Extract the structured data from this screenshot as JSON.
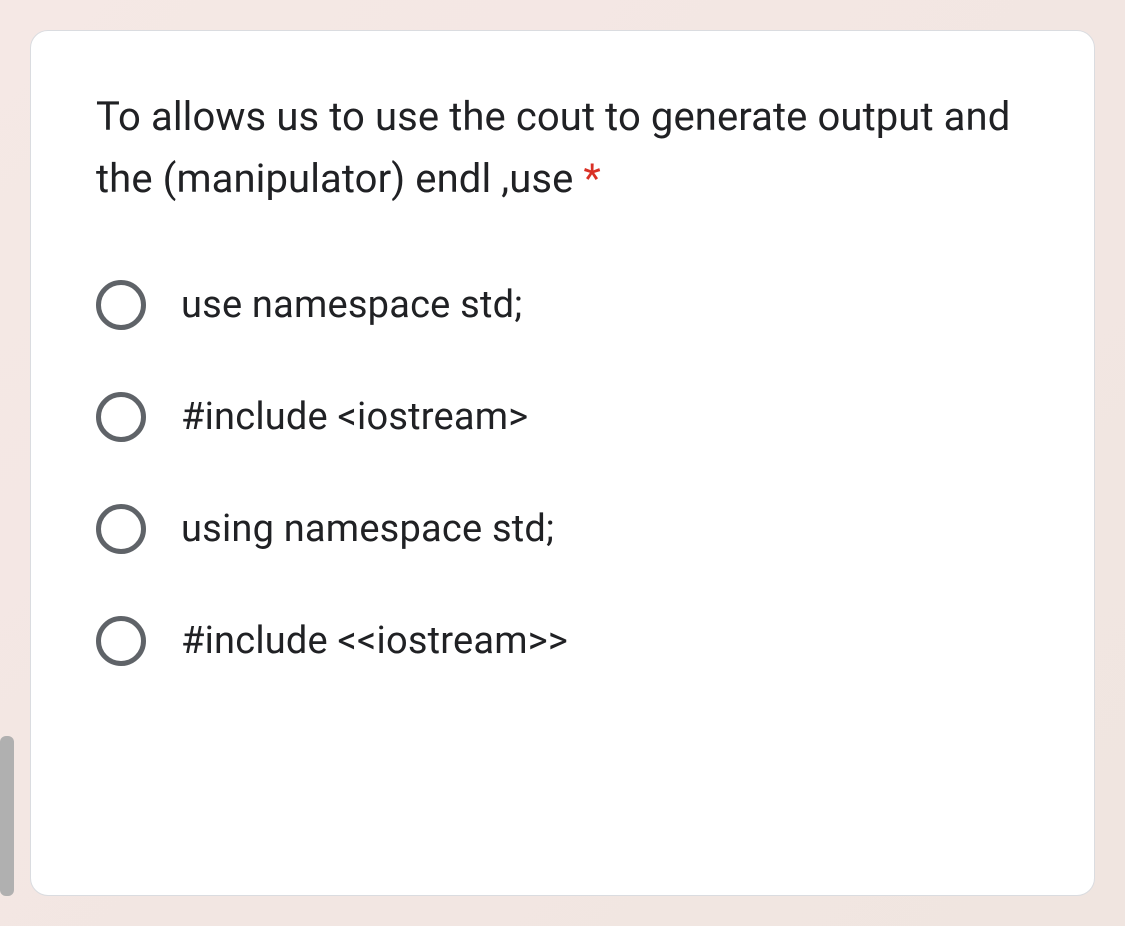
{
  "question": {
    "text": "To allows us to use the cout to generate output and the (manipulator) endl ,use ",
    "required_marker": "*"
  },
  "options": [
    {
      "label": "use namespace std;"
    },
    {
      "label": "#include <iostream>"
    },
    {
      "label": "using namespace std;"
    },
    {
      "label": "#include <<iostream>>"
    }
  ]
}
